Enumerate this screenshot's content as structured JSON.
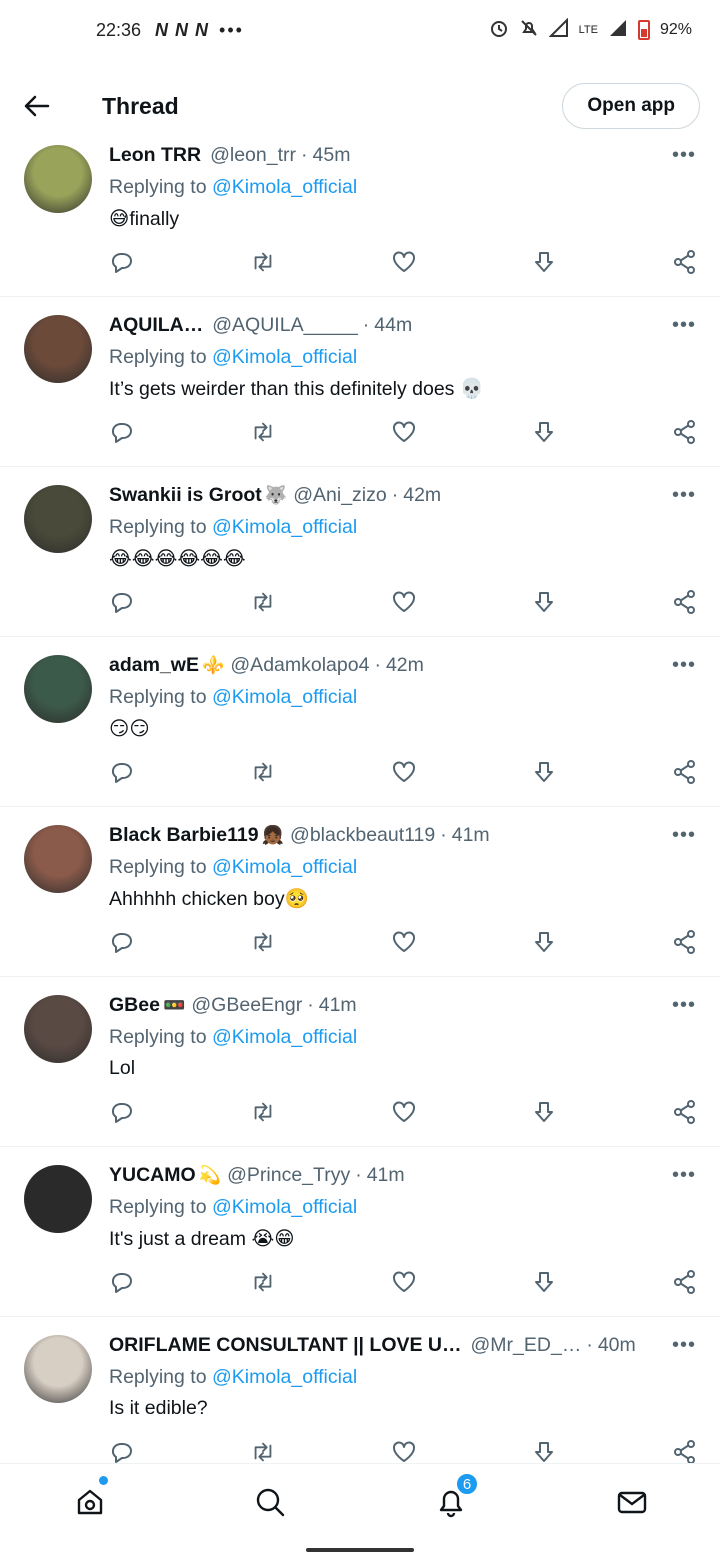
{
  "status_bar": {
    "time": "22:36",
    "left_icons": "N N N",
    "dots": "•••",
    "network": "LTE",
    "battery": "92%"
  },
  "header": {
    "title": "Thread",
    "open_app_label": "Open app"
  },
  "replying_label": "Replying to",
  "replies": [
    {
      "name": "Leon TRR",
      "badge": "",
      "handle": "@leon_trr",
      "time": "45m",
      "replying_to": "@Kimola_official",
      "text": "😅finally",
      "avatar_color": "#9aa35a"
    },
    {
      "name": "AQUILA…",
      "badge": "",
      "handle": "@AQUILA_____",
      "time": "44m",
      "replying_to": "@Kimola_official",
      "text": "It’s gets weirder than this definitely does 💀",
      "avatar_color": "#6b4a3a"
    },
    {
      "name": "Swankii is Groot",
      "badge": "🐺",
      "handle": "@Ani_zizo",
      "time": "42m",
      "replying_to": "@Kimola_official",
      "text": "😂😂😂😂😂😂",
      "avatar_color": "#4a4a3a"
    },
    {
      "name": "adam_wE",
      "badge": "⚜️",
      "handle": "@Adamkolapo4",
      "time": "42m",
      "replying_to": "@Kimola_official",
      "text": "😏😏",
      "avatar_color": "#3c5a4a"
    },
    {
      "name": "Black Barbie119",
      "badge": "👧🏾",
      "handle": "@blackbeaut119",
      "time": "41m",
      "replying_to": "@Kimola_official",
      "text": "Ahhhhh chicken boy🥺",
      "avatar_color": "#8a5a4a"
    },
    {
      "name": "GBee",
      "badge": "🚥",
      "handle": "@GBeeEngr",
      "time": "41m",
      "replying_to": "@Kimola_official",
      "text": "Lol",
      "avatar_color": "#5a4a44"
    },
    {
      "name": "YUCAMO",
      "badge": "💫",
      "handle": "@Prince_Tryy",
      "time": "41m",
      "replying_to": "@Kimola_official",
      "text": "It's just a dream 😭😁",
      "avatar_color": "#2a2a2a"
    },
    {
      "name": "ORIFLAME CONSULTANT || LOVE U…",
      "badge": "",
      "handle": "@Mr_ED_…",
      "time": "40m",
      "replying_to": "@Kimola_official",
      "text": "Is it edible?",
      "avatar_color": "#d8cfc4"
    }
  ],
  "more_icon": "•••",
  "nav": {
    "notifications_count": "6"
  },
  "colors": {
    "accent": "#1d9bf0",
    "secondary_text": "#536471"
  }
}
